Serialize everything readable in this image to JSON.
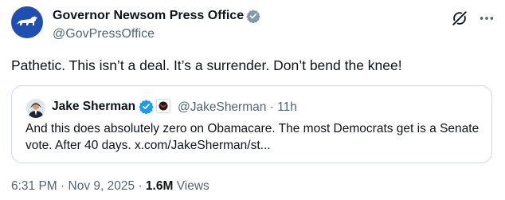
{
  "author": {
    "name": "Governor Newsom Press Office",
    "handle": "@GovPressOffice",
    "verified": true,
    "avatar_icon": "california-bear-icon",
    "avatar_color": "#1f4fb3"
  },
  "tweet": {
    "text": "Pathetic. This isn’t a deal. It’s a surrender. Don’t bend the knee!"
  },
  "quote": {
    "name": "Jake Sherman",
    "handle": "@JakeSherman",
    "separator": "·",
    "time": "11h",
    "text": "And this does absolutely zero on Obamacare. The most Democrats get is a Senate vote. After 40 days. x.com/JakeSherman/st..."
  },
  "meta": {
    "time": "6:31 PM",
    "separator1": "·",
    "date": "Nov 9, 2025",
    "separator2": "·",
    "views_count": "1.6M",
    "views_label": "Views"
  },
  "colors": {
    "verified_blue": "#1d9bf0",
    "muted_text": "#536471",
    "border": "#cfd9de"
  },
  "icons": [
    "verified-badge-icon",
    "grok-icon",
    "more-icon",
    "affiliate-badge-icon"
  ]
}
